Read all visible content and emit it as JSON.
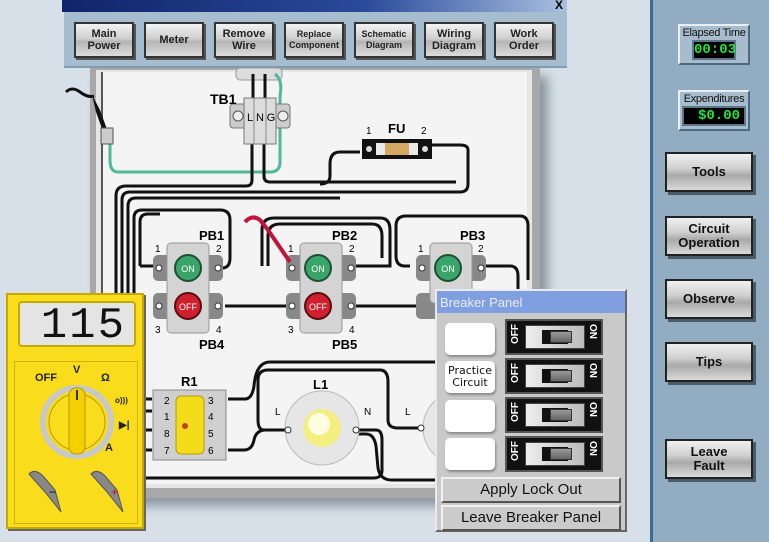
{
  "window": {
    "close_label": "X"
  },
  "toolbar": {
    "buttons": [
      {
        "id": "main-power",
        "label": "Main\nPower"
      },
      {
        "id": "meter",
        "label": "Meter"
      },
      {
        "id": "remove-wire",
        "label": "Remove\nWire"
      },
      {
        "id": "replace-component",
        "label": "Replace\nComponent"
      },
      {
        "id": "schematic-diagram",
        "label": "Schematic\nDiagram"
      },
      {
        "id": "wiring-diagram",
        "label": "Wiring\nDiagram"
      },
      {
        "id": "work-order",
        "label": "Work\nOrder"
      }
    ]
  },
  "right_panel": {
    "elapsed_time": {
      "label": "Elapsed Time",
      "value": "00:03"
    },
    "expenditures": {
      "label": "Expenditures",
      "value": "$0.00"
    },
    "buttons": [
      {
        "id": "tools",
        "label": "Tools"
      },
      {
        "id": "circuit-operation",
        "label": "Circuit\nOperation"
      },
      {
        "id": "observe",
        "label": "Observe"
      },
      {
        "id": "tips",
        "label": "Tips"
      },
      {
        "id": "leave-fault",
        "label": "Leave\nFault"
      }
    ]
  },
  "board": {
    "components": {
      "tb1": {
        "label": "TB1",
        "terminals": [
          "L",
          "N",
          "G"
        ]
      },
      "fu": {
        "label": "FU",
        "pin1": "1",
        "pin2": "2"
      },
      "pb1": {
        "label": "PB1",
        "button": "ON",
        "pin1": "1",
        "pin2": "2"
      },
      "pb2": {
        "label": "PB2",
        "button": "ON",
        "pin1": "1",
        "pin2": "2"
      },
      "pb3": {
        "label": "PB3",
        "button": "ON",
        "pin1": "1",
        "pin2": "2"
      },
      "pb4": {
        "label": "PB4",
        "button": "OFF",
        "pin3": "3",
        "pin4": "4"
      },
      "pb5": {
        "label": "PB5",
        "button": "OFF",
        "pin3": "3",
        "pin4": "4"
      },
      "r1": {
        "label": "R1",
        "left_pins": [
          "2",
          "1",
          "8",
          "7"
        ],
        "right_pins": [
          "3",
          "4",
          "5",
          "6"
        ]
      },
      "l1": {
        "label": "L1",
        "left": "L",
        "right": "N"
      },
      "l2": {
        "left": "L"
      }
    }
  },
  "meter": {
    "reading": "115",
    "dial_labels": {
      "off": "OFF",
      "volts": "V",
      "ohms": "Ω",
      "continuity": "o)))",
      "diode": "▶|",
      "amps": "A"
    },
    "selected_mode": "V",
    "probe_neg": "−",
    "probe_pos": "+"
  },
  "breaker_panel": {
    "title": "Breaker Panel",
    "circuits": [
      {
        "label": "",
        "off": "OFF",
        "on": "ON",
        "state": "on"
      },
      {
        "label": "Practice\nCircuit",
        "off": "OFF",
        "on": "ON",
        "state": "on"
      },
      {
        "label": "",
        "off": "OFF",
        "on": "ON",
        "state": "on"
      },
      {
        "label": "",
        "off": "OFF",
        "on": "ON",
        "state": "on"
      }
    ],
    "apply_lock_out": "Apply Lock Out",
    "leave": "Leave Breaker Panel"
  },
  "colors": {
    "on_button": "#3aa56a",
    "off_button": "#d0202e",
    "ground_wire": "#4fb89a",
    "meter_body": "#f9dc1b",
    "readout_green": "#1fe63a",
    "probe_red": "#c0143c"
  }
}
